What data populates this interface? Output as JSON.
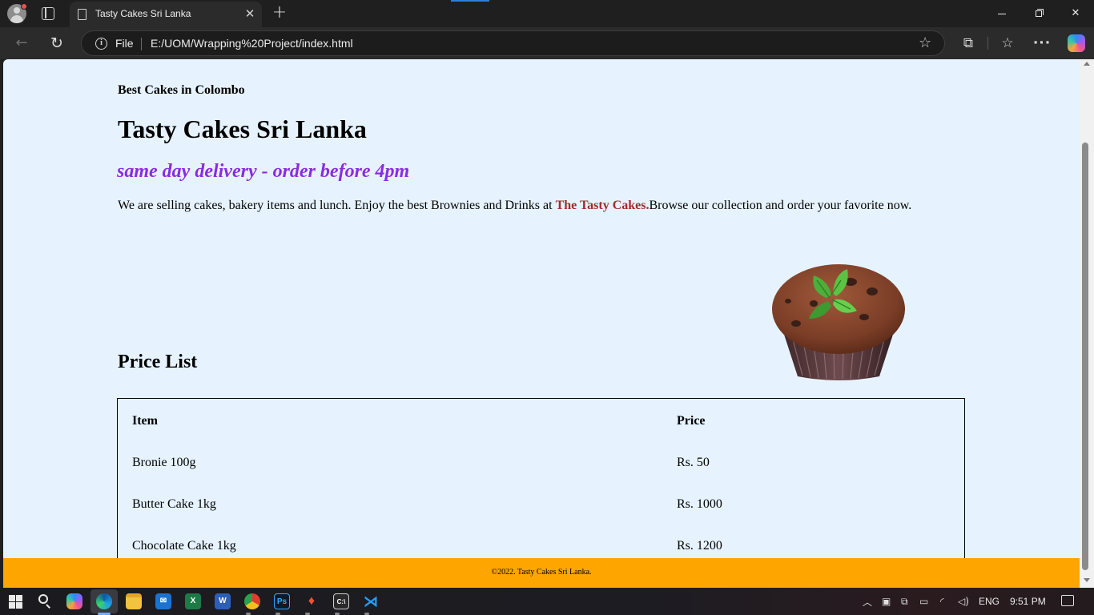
{
  "browser": {
    "tab_title": "Tasty Cakes Sri Lanka",
    "address_scheme_label": "File",
    "url": "E:/UOM/Wrapping%20Project/index.html",
    "icons": [
      "profile-icon",
      "tab-actions-icon",
      "page-icon",
      "close-icon",
      "plus-icon",
      "back-arrow-icon",
      "reload-icon",
      "info-icon",
      "star-icon",
      "extensions-icon",
      "favorites-icon",
      "more-icon",
      "copilot-icon"
    ]
  },
  "page": {
    "tagline": "Best Cakes in Colombo",
    "title": "Tasty Cakes Sri Lanka",
    "delivery_note": "same day delivery - order before 4pm",
    "intro_before": "We are selling cakes, bakery items and lunch. Enjoy the best Brownies and Drinks at ",
    "intro_brand": "The Tasty Cakes.",
    "intro_after": "Browse our collection and order your favorite now.",
    "price_list_heading": "Price List",
    "table": {
      "headers": [
        "Item",
        "Price"
      ],
      "rows": [
        [
          "Bronie 100g",
          "Rs. 50"
        ],
        [
          "Butter Cake 1kg",
          "Rs. 1000"
        ],
        [
          "Chocolate Cake 1kg",
          "Rs. 1200"
        ]
      ]
    },
    "footer": "©2022. Tasty Cakes Sri Lanka.",
    "colors": {
      "background": "#e6f3fe",
      "delivery": "#8a2be2",
      "brand": "#a52a2a",
      "footer": "#ffa500"
    }
  },
  "taskbar": {
    "language": "ENG",
    "time": "9:51 PM",
    "apps": [
      "start",
      "search",
      "copilot",
      "edge",
      "file-explorer",
      "mail",
      "excel",
      "word",
      "chrome",
      "photoshop",
      "git",
      "terminal",
      "vscode"
    ],
    "app_labels": {
      "excel": "X",
      "word": "W",
      "photoshop": "Ps",
      "terminal": "C:\\"
    }
  }
}
